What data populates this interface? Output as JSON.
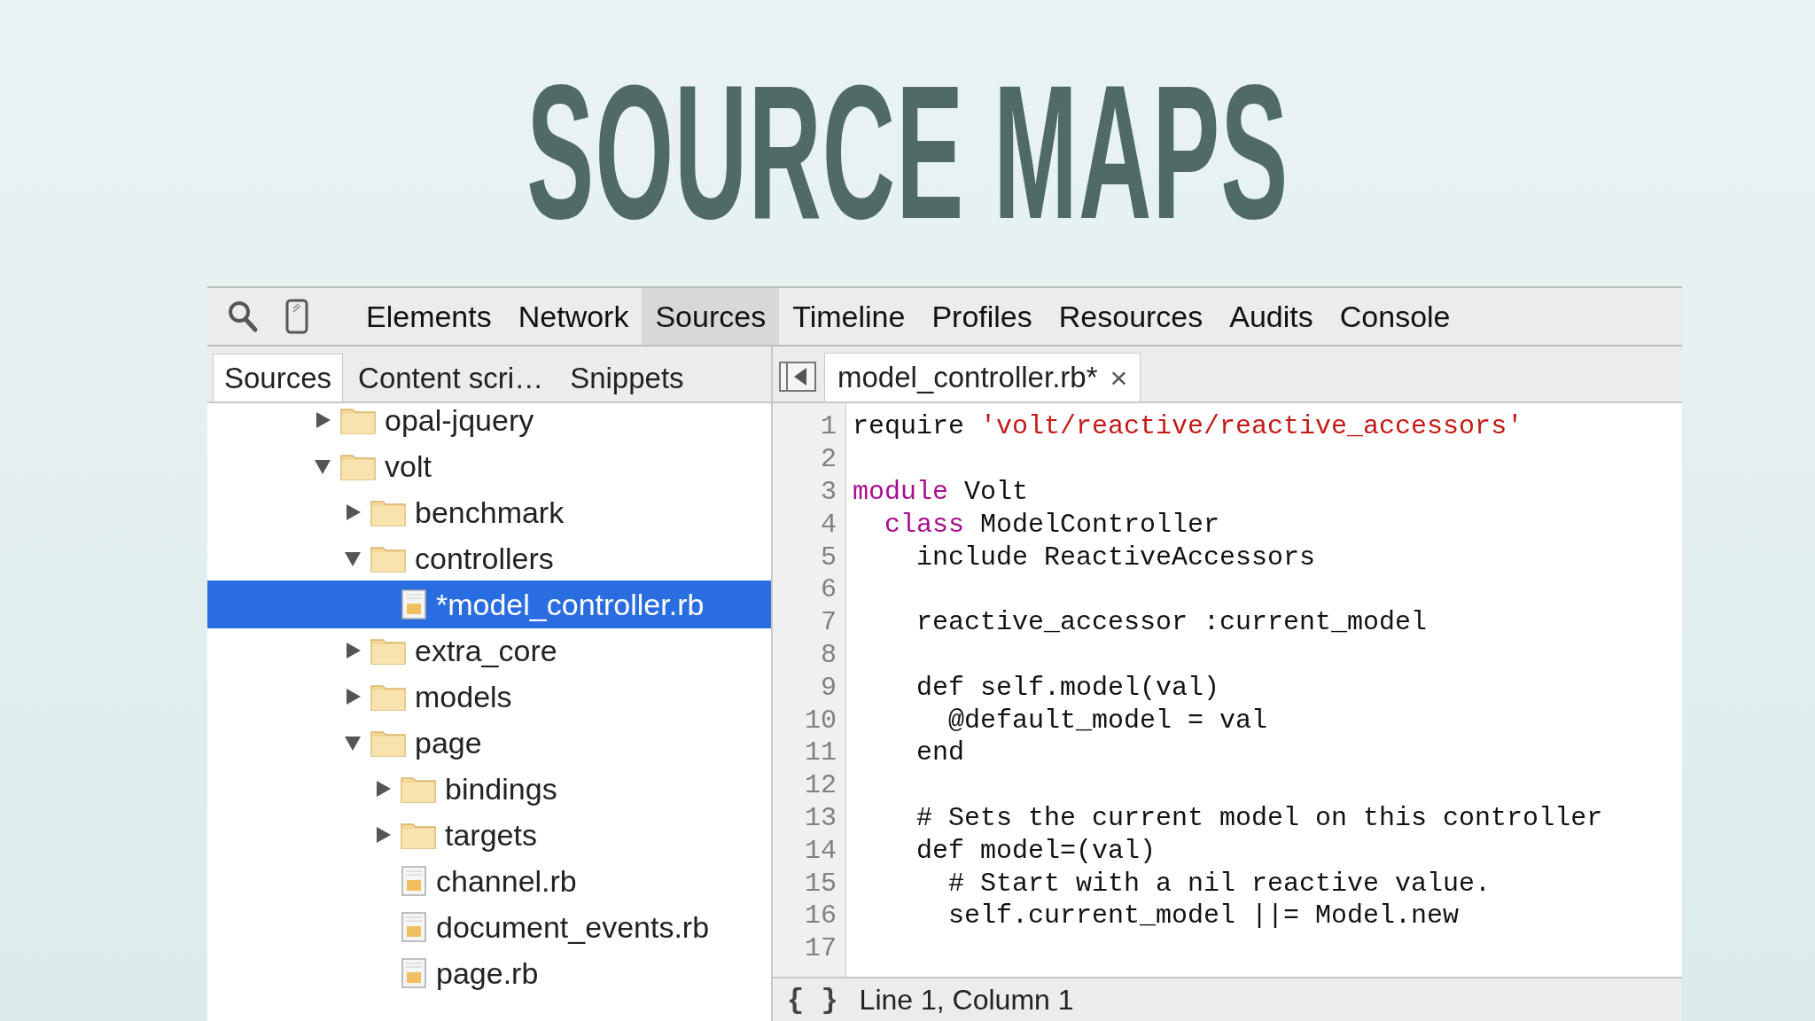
{
  "slide_title": "SOURCE MAPS",
  "toolbar": {
    "tabs": [
      {
        "label": "Elements",
        "selected": false
      },
      {
        "label": "Network",
        "selected": false
      },
      {
        "label": "Sources",
        "selected": true
      },
      {
        "label": "Timeline",
        "selected": false
      },
      {
        "label": "Profiles",
        "selected": false
      },
      {
        "label": "Resources",
        "selected": false
      },
      {
        "label": "Audits",
        "selected": false
      },
      {
        "label": "Console",
        "selected": false
      }
    ]
  },
  "navigator": {
    "tabs": [
      {
        "label": "Sources",
        "selected": true
      },
      {
        "label": "Content scri…",
        "selected": false
      },
      {
        "label": "Snippets",
        "selected": false
      }
    ],
    "tree": [
      {
        "kind": "folder",
        "name": "opal-jquery",
        "expanded": false,
        "selected": false
      },
      {
        "kind": "folder",
        "name": "volt",
        "expanded": true,
        "selected": false,
        "children": [
          {
            "kind": "folder",
            "name": "benchmark",
            "expanded": false,
            "selected": false
          },
          {
            "kind": "folder",
            "name": "controllers",
            "expanded": true,
            "selected": false,
            "children": [
              {
                "kind": "file",
                "name": "*model_controller.rb",
                "selected": true
              }
            ]
          },
          {
            "kind": "folder",
            "name": "extra_core",
            "expanded": false,
            "selected": false
          },
          {
            "kind": "folder",
            "name": "models",
            "expanded": false,
            "selected": false
          },
          {
            "kind": "folder",
            "name": "page",
            "expanded": true,
            "selected": false,
            "children": [
              {
                "kind": "folder",
                "name": "bindings",
                "expanded": false,
                "selected": false
              },
              {
                "kind": "folder",
                "name": "targets",
                "expanded": false,
                "selected": false
              },
              {
                "kind": "file",
                "name": "channel.rb",
                "selected": false
              },
              {
                "kind": "file",
                "name": "document_events.rb",
                "selected": false
              },
              {
                "kind": "file",
                "name": "page.rb",
                "selected": false
              }
            ]
          }
        ]
      }
    ]
  },
  "editor": {
    "tab": {
      "label": "model_controller.rb*",
      "close": "×"
    },
    "lines": [
      {
        "number": "1",
        "tokens": [
          {
            "kind": "plain",
            "text": "require "
          },
          {
            "kind": "string",
            "text": "'volt/reactive/reactive_accessors'"
          }
        ]
      },
      {
        "number": "2"
      },
      {
        "number": "3",
        "tokens": [
          {
            "kind": "keyword",
            "text": "module"
          },
          {
            "kind": "plain",
            "text": " Volt"
          }
        ]
      },
      {
        "number": "4",
        "tokens": [
          {
            "kind": "keyword",
            "text": "  class"
          },
          {
            "kind": "plain",
            "text": " ModelController"
          }
        ]
      },
      {
        "number": "5",
        "tokens": [
          {
            "kind": "plain",
            "text": "    include ReactiveAccessors"
          }
        ]
      },
      {
        "number": "6"
      },
      {
        "number": "7",
        "tokens": [
          {
            "kind": "plain",
            "text": "    reactive_accessor :current_model"
          }
        ]
      },
      {
        "number": "8"
      },
      {
        "number": "9",
        "tokens": [
          {
            "kind": "plain",
            "text": "    def self.model(val)"
          }
        ]
      },
      {
        "number": "10",
        "tokens": [
          {
            "kind": "plain",
            "text": "      @default_model = val"
          }
        ]
      },
      {
        "number": "11",
        "tokens": [
          {
            "kind": "plain",
            "text": "    end"
          }
        ]
      },
      {
        "number": "12"
      },
      {
        "number": "13",
        "tokens": [
          {
            "kind": "plain",
            "text": "    # Sets the current model on this controller"
          }
        ]
      },
      {
        "number": "14",
        "tokens": [
          {
            "kind": "plain",
            "text": "    def model=(val)"
          }
        ]
      },
      {
        "number": "15",
        "tokens": [
          {
            "kind": "plain",
            "text": "      # Start with a nil reactive value."
          }
        ]
      },
      {
        "number": "16",
        "tokens": [
          {
            "kind": "plain",
            "text": "      self.current_model ||= Model.new"
          }
        ]
      },
      {
        "number": "17"
      }
    ],
    "status": {
      "format_button": "{ }",
      "position": "Line 1, Column 1"
    }
  }
}
